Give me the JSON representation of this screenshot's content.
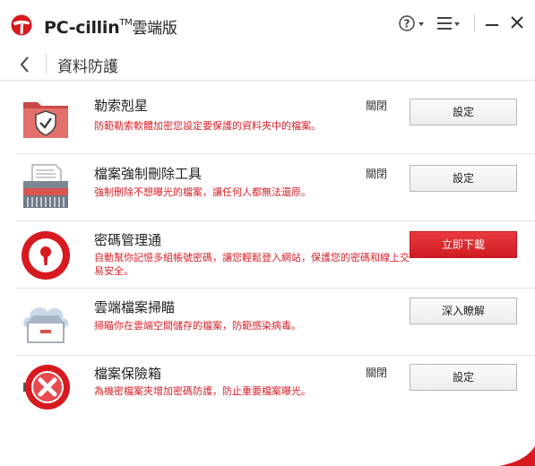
{
  "app": {
    "name": "PC-cillin",
    "trademark": "TM",
    "edition": "雲端版",
    "brand_color": "#d71920"
  },
  "titlebar": {
    "help_icon": "question-circle-icon",
    "menu_icon": "hamburger-menu-icon",
    "minimize_icon": "minimize-icon",
    "close_icon": "close-icon"
  },
  "header": {
    "back_icon": "chevron-left-icon",
    "title": "資料防護"
  },
  "rows": [
    {
      "title": "勒索剋星",
      "description": "防範勒索軟體加密您設定要保護的資料夾中的檔案。",
      "status": "關閉",
      "button": "設定",
      "icon": "folder-shield-icon"
    },
    {
      "title": "檔案強制刪除工具",
      "description": "強制刪除不想曝光的檔案，讓任何人都無法還原。",
      "status": "關閉",
      "button": "設定",
      "icon": "shredder-icon"
    },
    {
      "title": "密碼管理通",
      "description": "自動幫你記憶多組帳號密碼，讓您輕鬆登入網站，保護您的密碼和線上交易安全。",
      "status": "",
      "button": "立即下載",
      "icon": "password-keyhole-icon"
    },
    {
      "title": "雲端檔案掃瞄",
      "description": "掃瞄你在雲端空間儲存的檔案，防範感染病毒。",
      "status": "",
      "button": "深入瞭解",
      "icon": "cloud-drawer-icon"
    },
    {
      "title": "檔案保險箱",
      "description": "為機密檔案夾增加密碼防護，防止重要檔案曝光。",
      "status": "關閉",
      "button": "設定",
      "icon": "vault-icon"
    }
  ]
}
